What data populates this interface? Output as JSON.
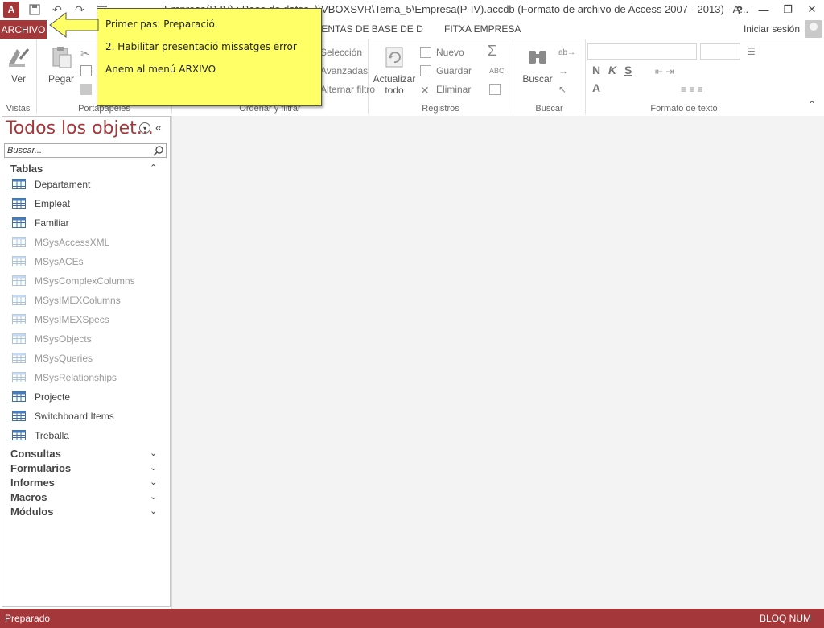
{
  "window": {
    "title": "Empresa(P-IV) : Base de datos- \\\\VBOXSVR\\Tema_5\\Empresa(P-IV).accdb (Formato de archivo de Access 2007 - 2013) - A...",
    "help": "?",
    "min": "—",
    "restore": "❐",
    "close": "✕"
  },
  "app_logo": "A",
  "tabs": {
    "file": "ARCHIVO",
    "db_tools": "HERRAMIENTAS DE BASE DE DATOS",
    "custom": "FITXA EMPRESA"
  },
  "account": {
    "signin": "Iniciar sesión"
  },
  "ribbon": {
    "vistas": {
      "label": "Vistas",
      "ver": "Ver"
    },
    "portapapeles": {
      "label": "Portapapeles",
      "pegar": "Pegar"
    },
    "ordenar": {
      "label": "Ordenar y filtrar",
      "seleccion": "Selección",
      "avanzadas": "Avanzadas",
      "quitar_filtro": "Alternar filtro"
    },
    "registros": {
      "label": "Registros",
      "actualizar": "Actualizar",
      "todo": "todo",
      "nuevo": "Nuevo",
      "guardar": "Guardar",
      "eliminar": "Eliminar"
    },
    "buscar": {
      "label": "Buscar",
      "buscar_btn": "Buscar"
    },
    "formato": {
      "label": "Formato de texto",
      "bold": "N",
      "italic": "K",
      "underline": "S",
      "font_color": "A"
    }
  },
  "callout": {
    "line1": "Primer pas: Preparació.",
    "line2": "2. Habilitar presentació missatges error",
    "line3": "Anem al menú ARXIVO"
  },
  "nav": {
    "header": "Todos los objet...",
    "collapse": "«",
    "search_placeholder": "Buscar...",
    "sections": {
      "tablas": "Tablas",
      "consultas": "Consultas",
      "formularios": "Formularios",
      "informes": "Informes",
      "macros": "Macros",
      "modulos": "Módulos"
    },
    "tables": [
      {
        "name": "Departament",
        "system": false
      },
      {
        "name": "Empleat",
        "system": false
      },
      {
        "name": "Familiar",
        "system": false
      },
      {
        "name": "MSysAccessXML",
        "system": true
      },
      {
        "name": "MSysACEs",
        "system": true
      },
      {
        "name": "MSysComplexColumns",
        "system": true
      },
      {
        "name": "MSysIMEXColumns",
        "system": true
      },
      {
        "name": "MSysIMEXSpecs",
        "system": true
      },
      {
        "name": "MSysObjects",
        "system": true
      },
      {
        "name": "MSysQueries",
        "system": true
      },
      {
        "name": "MSysRelationships",
        "system": true
      },
      {
        "name": "Projecte",
        "system": false
      },
      {
        "name": "Switchboard Items",
        "system": false
      },
      {
        "name": "Treballa",
        "system": false
      }
    ]
  },
  "status": {
    "left": "Preparado",
    "right": "BLOQ NUM"
  },
  "colors": {
    "accent": "#a4373a",
    "callout": "#ffff66"
  }
}
